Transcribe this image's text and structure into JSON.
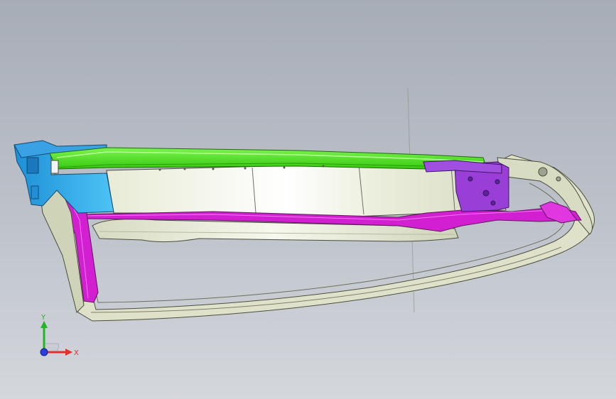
{
  "viewport": {
    "background_top": "#a7adb7",
    "background_bottom": "#d4d7dc"
  },
  "model": {
    "body_color": "#e9ecd7",
    "edge_color": "#4a4e3e",
    "green_part": "#49e31b",
    "magenta_part": "#d21fd2",
    "blue_part": "#2aa8e8",
    "purple_part": "#9a3ed8"
  },
  "triad": {
    "x_label": "X",
    "y_label": "Y",
    "x_color": "#e03030",
    "y_color": "#22b422",
    "z_color": "#2b3fe0"
  }
}
